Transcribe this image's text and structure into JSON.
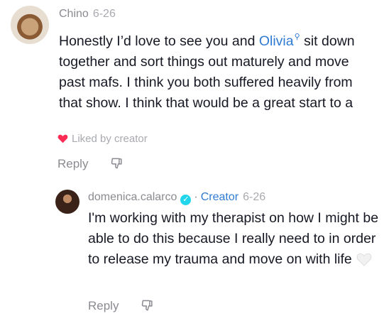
{
  "comments": [
    {
      "username": "Chino",
      "date": "6-26",
      "text_before": "Honestly I’d love to see you and ",
      "mention": "Olivia",
      "text_after": " sit down together and sort things out maturely and move past mafs. I think you both suffered heavily from that show. I think that would be a great start to a",
      "liked_label": "Liked by creator",
      "reply_label": "Reply"
    },
    {
      "username": "domenica.calarco",
      "separator": "·",
      "creator_label": "Creator",
      "date": "6-26",
      "text": "I'm working with my therapist on how I might be able to do this because I really need to in order to release my trauma and move on with life",
      "reply_label": "Reply"
    }
  ],
  "icons": {
    "mention_search": "search-icon",
    "liked_heart": "heart-icon",
    "white_heart": "white-heart-icon",
    "verified": "verified-badge-icon",
    "dislike": "dislike-icon"
  },
  "colors": {
    "text": "#161823",
    "secondary": "#8a8b91",
    "mention": "#2f7bd3",
    "verified": "#20d5ec",
    "heart": "#fe2c55"
  }
}
